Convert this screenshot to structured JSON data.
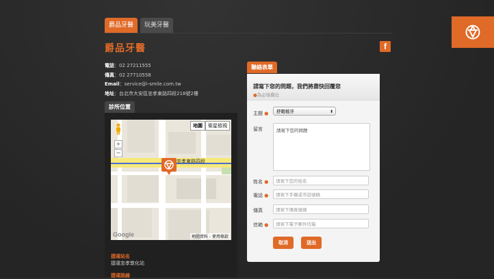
{
  "tabs": [
    {
      "label": "爵品牙醫"
    },
    {
      "label": "玩美牙醫"
    }
  ],
  "clinic": {
    "name": "爵品牙醫",
    "phone_label": "電話",
    "phone": "02 27211555",
    "fax_label": "傳真",
    "fax": "02 27710558",
    "email_label": "Email",
    "email": "service@i-smile.com.tw",
    "address_label": "地址",
    "address": "台北市大安區忠孝東路四段218號2樓"
  },
  "facebook": {
    "label": "f"
  },
  "location": {
    "section_label": "診所位置",
    "map_type_map": "地圖",
    "map_type_satellite": "衛星檢視",
    "road_name": "忠孝東路四段",
    "map_footer": "地圖資料 - 使用條款",
    "google": "Google",
    "zoom_in": "+",
    "zoom_out": "−",
    "station_heading": "捷運站名",
    "station_value": "捷運忠孝敦化站",
    "route_heading": "捷運路線"
  },
  "contact": {
    "section_label": "聯絡表單",
    "heading": "請寫下您的問題，我們將盡快回覆您",
    "required_note": "為必填欄位",
    "subject_label": "主題",
    "subject_value": "舒眠植牙",
    "message_label": "留言",
    "message_placeholder": "請寫下您的問題",
    "name_label": "姓名",
    "name_placeholder": "請寫下您的姓名",
    "phone_label": "電話",
    "phone_placeholder": "請寫下手機或市話號碼",
    "fax_label": "傳真",
    "fax_placeholder": "請寫下傳真號碼",
    "email_label": "信箱",
    "email_placeholder": "請寫下電子郵件信箱",
    "cancel_label": "取消",
    "submit_label": "送出"
  },
  "colors": {
    "accent": "#e06a28",
    "background": "#2b2b2b"
  }
}
